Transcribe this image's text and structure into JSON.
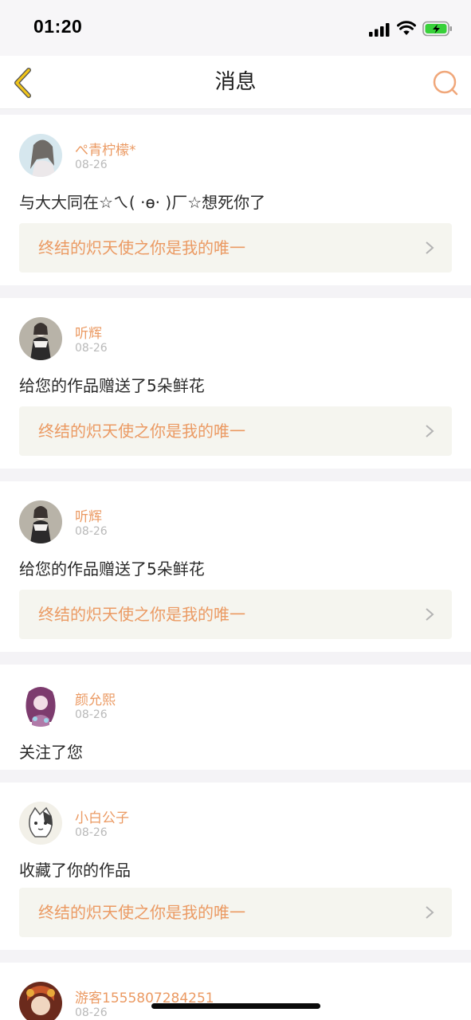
{
  "status_bar": {
    "time": "01:20"
  },
  "header": {
    "title": "消息",
    "back_icon": "back-chevron-icon",
    "search_icon": "search-icon"
  },
  "colors": {
    "accent": "#eb9a63",
    "back_icon": "#f0c419",
    "date": "#b9b9b9",
    "link_bg": "#f5f5ef"
  },
  "messages": [
    {
      "user": "ぺ青柠檬*",
      "date": "08-26",
      "text": "与大大同在☆ㄟ( ·ɵ· )厂☆想死你了",
      "work_title": "终结的炽天使之你是我的唯一"
    },
    {
      "user": "听辉",
      "date": "08-26",
      "text": "给您的作品赠送了5朵鲜花",
      "work_title": "终结的炽天使之你是我的唯一"
    },
    {
      "user": "听辉",
      "date": "08-26",
      "text": "给您的作品赠送了5朵鲜花",
      "work_title": "终结的炽天使之你是我的唯一"
    },
    {
      "user": "颜允熙",
      "date": "08-26",
      "text": "关注了您"
    },
    {
      "user": "小白公子",
      "date": "08-26",
      "text": "收藏了你的作品",
      "work_title": "终结的炽天使之你是我的唯一"
    },
    {
      "user": "游客1555807284251",
      "date": "08-26"
    }
  ]
}
